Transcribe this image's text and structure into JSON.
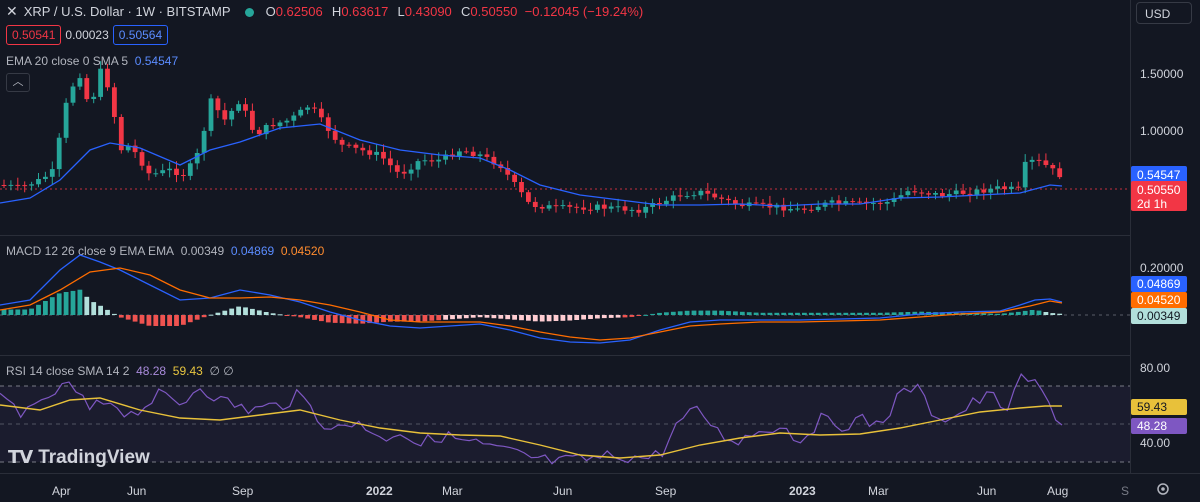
{
  "header": {
    "close_icon": "close-icon",
    "symbol": "XRP / U.S. Dollar · 1W · BITSTAMP",
    "market_status_color": "#26a69a",
    "open_label": "O",
    "open": "0.62506",
    "high_label": "H",
    "high": "0.63617",
    "low_label": "L",
    "low": "0.43090",
    "close_label": "C",
    "close": "0.50550",
    "change": "−0.12045 (−19.24%)"
  },
  "trade": {
    "sell": "0.50541",
    "spread": "0.00023",
    "buy": "0.50564"
  },
  "currency": "USD",
  "ema_legend": {
    "label": "EMA 20 close 0 SMA 5",
    "value": "0.54547"
  },
  "macd_legend": {
    "label": "MACD 12 26 close 9 EMA EMA",
    "hist": "0.00349",
    "macd": "0.04869",
    "signal": "0.04520"
  },
  "rsi_legend": {
    "label": "RSI 14 close SMA 14 2",
    "rsi": "48.28",
    "sma": "59.43",
    "flags": "∅ ∅"
  },
  "price_axis": {
    "ticks": [
      "1.50000",
      "1.00000"
    ],
    "ema_tag": "0.54547",
    "price_tag": "0.50550",
    "countdown": "2d 1h"
  },
  "macd_axis": {
    "tick": "0.20000",
    "macd_tag": "0.04869",
    "signal_tag": "0.04520",
    "hist_tag": "0.00349"
  },
  "rsi_axis": {
    "ticks": [
      "80.00",
      "40.00"
    ],
    "sma_tag": "59.43",
    "rsi_tag": "48.28"
  },
  "time_axis": [
    "Apr",
    "Jun",
    "Sep",
    "2022",
    "Mar",
    "Jun",
    "Sep",
    "2023",
    "Mar",
    "Jun",
    "Aug",
    "S"
  ],
  "logo": "TradingView",
  "colors": {
    "up": "#26a69a",
    "down": "#f23645",
    "ema": "#2962ff",
    "macd": "#2962ff",
    "signal": "#ff6d00",
    "rsi": "#7e57c2",
    "rsi_sma": "#e8c13a"
  },
  "chart_data": [
    {
      "type": "candlestick",
      "title": "XRP / U.S. Dollar · 1W · BITSTAMP",
      "x_labels": [
        "Apr",
        "Jun",
        "Sep",
        "2022",
        "Mar",
        "Jun",
        "Sep",
        "2023",
        "Mar",
        "Jun",
        "Aug"
      ],
      "ylim": [
        0.26,
        1.8
      ],
      "series": [
        {
          "name": "EMA 20 close 0 SMA 5",
          "color": "#2962ff",
          "values_approx": [
            0.42,
            0.9,
            1.02,
            1.0,
            0.95,
            0.75,
            0.5,
            0.42,
            0.43,
            0.43,
            0.48,
            0.5,
            0.545
          ]
        }
      ],
      "last_close": 0.5055
    },
    {
      "type": "line",
      "title": "MACD 12 26 close 9 EMA EMA",
      "series": [
        {
          "name": "MACD",
          "color": "#2962ff",
          "last": 0.04869
        },
        {
          "name": "Signal",
          "color": "#ff6d00",
          "last": 0.0452
        },
        {
          "name": "Histogram",
          "last": 0.00349
        }
      ],
      "ticks": [
        0.2
      ]
    },
    {
      "type": "line",
      "title": "RSI 14 close SMA 14 2",
      "ylim": [
        20,
        90
      ],
      "bands": [
        70,
        50,
        30
      ],
      "series": [
        {
          "name": "RSI",
          "color": "#7e57c2",
          "last": 48.28
        },
        {
          "name": "SMA",
          "color": "#e8c13a",
          "last": 59.43
        }
      ],
      "ticks": [
        80,
        40
      ]
    }
  ]
}
